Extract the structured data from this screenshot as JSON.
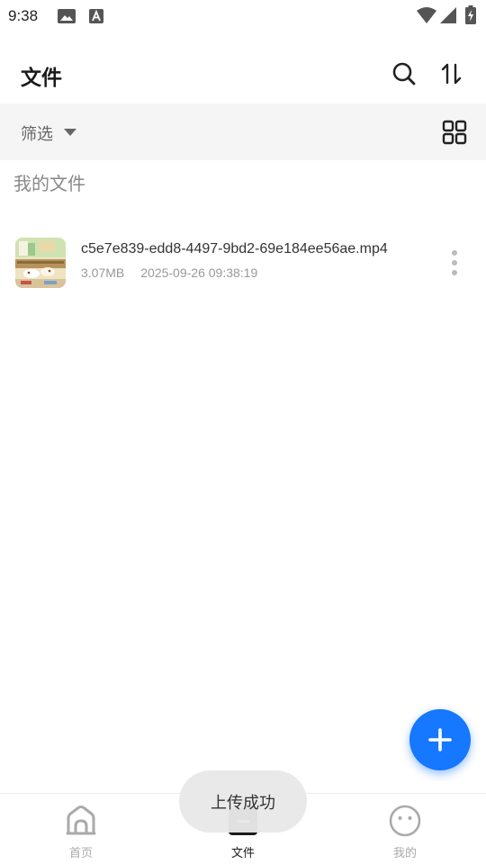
{
  "status_bar": {
    "time": "9:38",
    "icons": [
      "image-icon",
      "keyboard-a-icon",
      "wifi-icon",
      "signal-icon",
      "battery-charging-icon"
    ]
  },
  "app_bar": {
    "title": "文件",
    "actions": [
      "search-icon",
      "sort-icon"
    ]
  },
  "filter_bar": {
    "filter_label": "筛选",
    "view_toggle_icon": "grid-view-icon"
  },
  "section": {
    "title": "我的文件"
  },
  "files": [
    {
      "name": "c5e7e839-edd8-4497-9bd2-69e184ee56ae.mp4",
      "size": "3.07MB",
      "date": "2025-09-26 09:38:19"
    }
  ],
  "fab": {
    "icon": "plus-icon",
    "color": "#1677ff"
  },
  "bottom_nav": {
    "items": [
      {
        "label": "首页",
        "icon": "home-icon",
        "active": false
      },
      {
        "label": "文件",
        "icon": "file-icon",
        "active": true
      },
      {
        "label": "我的",
        "icon": "profile-icon",
        "active": false
      }
    ]
  },
  "toast": {
    "message": "上传成功"
  },
  "colors": {
    "accent": "#1677ff",
    "filter_bg": "#f5f5f5"
  }
}
